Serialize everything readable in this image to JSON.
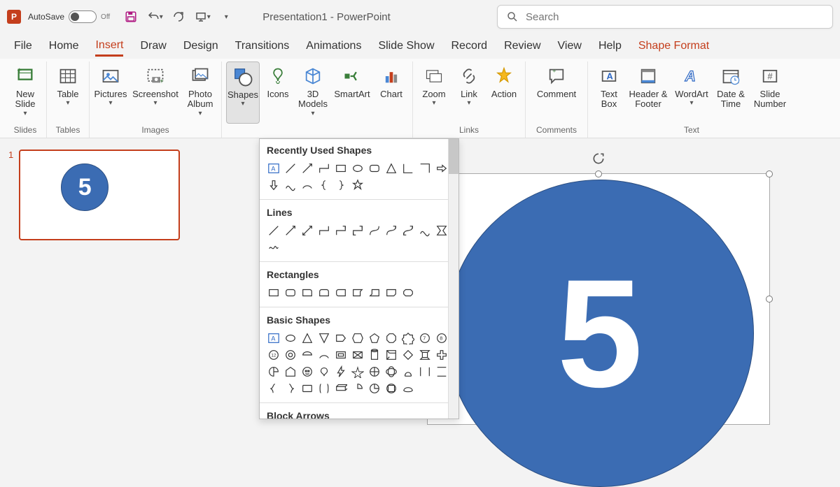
{
  "titlebar": {
    "autosave_label": "AutoSave",
    "autosave_state": "Off",
    "title": "Presentation1  -  PowerPoint",
    "search_placeholder": "Search"
  },
  "tabs": [
    "File",
    "Home",
    "Insert",
    "Draw",
    "Design",
    "Transitions",
    "Animations",
    "Slide Show",
    "Record",
    "Review",
    "View",
    "Help",
    "Shape Format"
  ],
  "active_tab": "Insert",
  "contextual_tab": "Shape Format",
  "ribbon": {
    "slides": {
      "label": "Slides",
      "new_slide": "New Slide"
    },
    "tables": {
      "label": "Tables",
      "table": "Table"
    },
    "images": {
      "label": "Images",
      "pictures": "Pictures",
      "screenshot": "Screenshot",
      "photo_album": "Photo Album"
    },
    "illustrations": {
      "shapes": "Shapes",
      "icons": "Icons",
      "models": "3D Models",
      "smartart": "SmartArt",
      "chart": "Chart"
    },
    "links": {
      "label": "Links",
      "zoom": "Zoom",
      "link": "Link",
      "action": "Action"
    },
    "comments": {
      "label": "Comments",
      "comment": "Comment"
    },
    "text": {
      "label": "Text",
      "text_box": "Text Box",
      "header_footer": "Header & Footer",
      "wordart": "WordArt",
      "date_time": "Date & Time",
      "slide_number": "Slide Number"
    }
  },
  "shapes_dropdown": {
    "sections": [
      "Recently Used Shapes",
      "Lines",
      "Rectangles",
      "Basic Shapes",
      "Block Arrows"
    ]
  },
  "thumbnail": {
    "number": "1",
    "circle_text": "5"
  },
  "canvas": {
    "circle_text": "5"
  }
}
